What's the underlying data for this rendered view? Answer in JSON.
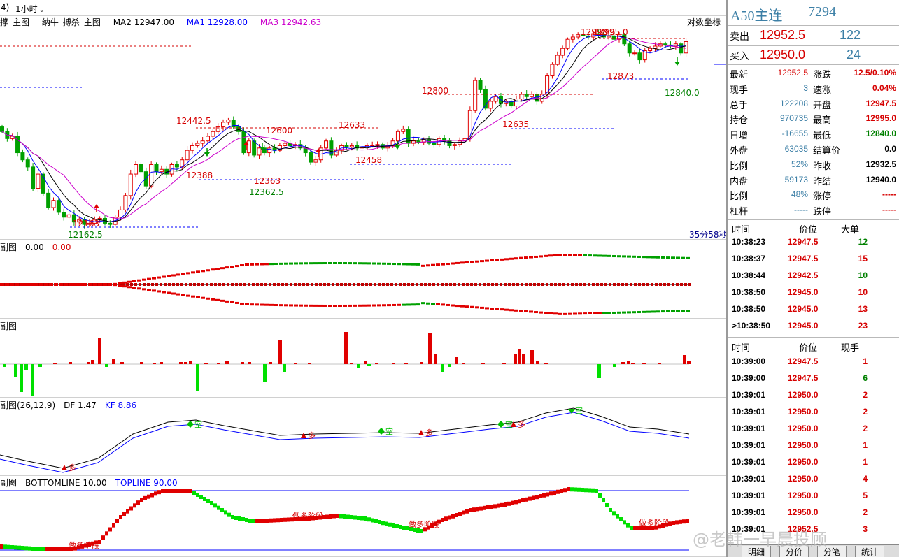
{
  "topbar": {
    "tab1": "4)",
    "tab2": "1小时"
  },
  "main_legend": {
    "name": "撑_主图",
    "name2": "纳牛_搏杀_主图",
    "ma2": "MA2 12947.00",
    "ma1": "MA1 12928.00",
    "ma3": "MA3 12942.63",
    "coord": "对数坐标",
    "countdown": "35分58秒"
  },
  "annotations": {
    "high": "12998.5",
    "high2": "12995.0",
    "a12873": "12873",
    "a12840": "12840.0",
    "a12800": "12800",
    "a12635": "12635",
    "a12633": "12633",
    "a12600": "12600",
    "a12458": "12458",
    "a12442": "12442.5",
    "a12388": "12388",
    "a12363": "12363",
    "a12362": "12362.5",
    "a12163": "12163",
    "a12162": "12162.5"
  },
  "sub1": {
    "name": "副图",
    "v1": "0.00",
    "v2": "0.00"
  },
  "sub2": {
    "name": "副图"
  },
  "sub3": {
    "name": "副图(26,12,9)",
    "df": "DF 1.47",
    "kf": "KF 8.86",
    "kong": "空",
    "duo": "多"
  },
  "sub4": {
    "name": "副图",
    "bottom": "BOTTOMLINE 10.00",
    "top": "TOPLINE 90.00",
    "stage": "做多阶段"
  },
  "quote": {
    "title": "A50主连",
    "code": "7294",
    "sell_label": "卖出",
    "sell_price": "12952.5",
    "sell_vol": "122",
    "buy_label": "买入",
    "buy_price": "12950.0",
    "buy_vol": "24",
    "stats_left": [
      {
        "k": "最新",
        "v": "12952.5",
        "c": "#d60000"
      },
      {
        "k": "现手",
        "v": "3",
        "c": "#3c7fa6"
      },
      {
        "k": "总手",
        "v": "122208",
        "c": "#3c7fa6"
      },
      {
        "k": "持仓",
        "v": "970735",
        "c": "#3c7fa6"
      },
      {
        "k": "日增",
        "v": "-16655",
        "c": "#3c7fa6"
      },
      {
        "k": "外盘",
        "v": "63035",
        "c": "#3c7fa6"
      },
      {
        "k": "比例",
        "v": "52%",
        "c": "#3c7fa6"
      },
      {
        "k": "内盘",
        "v": "59173",
        "c": "#3c7fa6"
      },
      {
        "k": "比例",
        "v": "48%",
        "c": "#3c7fa6"
      },
      {
        "k": "杠杆",
        "v": "-----",
        "c": "#3c7fa6"
      }
    ],
    "stats_right": [
      {
        "k": "涨跌",
        "v": "12.5/0.10%",
        "c": "#d60000"
      },
      {
        "k": "速涨",
        "v": "0.04%",
        "c": "#d60000"
      },
      {
        "k": "开盘",
        "v": "12947.5",
        "c": "#d60000"
      },
      {
        "k": "最高",
        "v": "12995.0",
        "c": "#d60000"
      },
      {
        "k": "最低",
        "v": "12840.0",
        "c": "#008000"
      },
      {
        "k": "结算价",
        "v": "0.0",
        "c": "#000000"
      },
      {
        "k": "昨收",
        "v": "12932.5",
        "c": "#000000"
      },
      {
        "k": "昨结",
        "v": "12940.0",
        "c": "#000000"
      },
      {
        "k": "涨停",
        "v": "-----",
        "c": "#d60000"
      },
      {
        "k": "跌停",
        "v": "-----",
        "c": "#d60000"
      }
    ]
  },
  "big_orders": {
    "headers": [
      "时间",
      "价位",
      "大单"
    ],
    "rows": [
      {
        "t": "10:38:23",
        "p": "12947.5",
        "v": "12",
        "c": "#008000"
      },
      {
        "t": "10:38:37",
        "p": "12947.5",
        "v": "15",
        "c": "#d60000"
      },
      {
        "t": "10:38:44",
        "p": "12942.5",
        "v": "10",
        "c": "#008000"
      },
      {
        "t": "10:38:50",
        "p": "12945.0",
        "v": "10",
        "c": "#d60000"
      },
      {
        "t": "10:38:50",
        "p": "12945.0",
        "v": "13",
        "c": "#d60000"
      },
      {
        "t": ">10:38:50",
        "p": "12945.0",
        "v": "23",
        "c": "#d60000"
      }
    ]
  },
  "ticks": {
    "headers": [
      "时间",
      "价位",
      "现手"
    ],
    "rows": [
      {
        "t": "10:39:00",
        "p": "12947.5",
        "v": "1",
        "c": "#d60000"
      },
      {
        "t": "10:39:00",
        "p": "12947.5",
        "v": "6",
        "c": "#008000"
      },
      {
        "t": "10:39:01",
        "p": "12950.0",
        "v": "2",
        "c": "#d60000"
      },
      {
        "t": "10:39:01",
        "p": "12950.0",
        "v": "2",
        "c": "#d60000"
      },
      {
        "t": "10:39:01",
        "p": "12950.0",
        "v": "2",
        "c": "#d60000"
      },
      {
        "t": "10:39:01",
        "p": "12950.0",
        "v": "1",
        "c": "#d60000"
      },
      {
        "t": "10:39:01",
        "p": "12950.0",
        "v": "1",
        "c": "#d60000"
      },
      {
        "t": "10:39:01",
        "p": "12950.0",
        "v": "4",
        "c": "#d60000"
      },
      {
        "t": "10:39:01",
        "p": "12950.0",
        "v": "5",
        "c": "#d60000"
      },
      {
        "t": "10:39:01",
        "p": "12950.0",
        "v": "2",
        "c": "#d60000"
      },
      {
        "t": "10:39:01",
        "p": "12952.5",
        "v": "3",
        "c": "#d60000"
      }
    ]
  },
  "tabs": [
    "明细",
    "分价",
    "分笔",
    "统计"
  ],
  "watermark": "@老韩一早晨投顾",
  "colors": {
    "up": "#e00000",
    "down": "#00a000",
    "ma1": "#000000",
    "ma2": "#0000ff",
    "ma3": "#cc00cc"
  },
  "chart_data": {
    "type": "candlestick",
    "y_axis": "log",
    "price_range": [
      12130,
      13010
    ],
    "candles_close": [
      12560,
      12530,
      12540,
      12470,
      12440,
      12410,
      12320,
      12380,
      12300,
      12240,
      12270,
      12220,
      12200,
      12210,
      12180,
      12190,
      12170,
      12175,
      12190,
      12195,
      12175,
      12170,
      12200,
      12230,
      12290,
      12380,
      12420,
      12390,
      12330,
      12420,
      12390,
      12400,
      12380,
      12420,
      12410,
      12440,
      12480,
      12500,
      12510,
      12520,
      12540,
      12560,
      12580,
      12600,
      12610,
      12580,
      12560,
      12470,
      12520,
      12460,
      12490,
      12470,
      12490,
      12480,
      12500,
      12510,
      12500,
      12505,
      12490,
      12470,
      12430,
      12440,
      12490,
      12520,
      12460,
      12480,
      12500,
      12495,
      12500,
      12490,
      12495,
      12500,
      12500,
      12505,
      12490,
      12500,
      12520,
      12560,
      12570,
      12510,
      12520,
      12515,
      12525,
      12510,
      12505,
      12530,
      12520,
      12500,
      12505,
      12520,
      12530,
      12650,
      12780,
      12740,
      12660,
      12690,
      12710,
      12680,
      12690,
      12670,
      12700,
      12720,
      12710,
      12720,
      12690,
      12720,
      12800,
      12850,
      12890,
      12920,
      12960,
      12970,
      12980,
      12975,
      12970,
      12985,
      12980,
      12970,
      12975,
      12960,
      12980,
      12940,
      12900,
      12900,
      12870,
      12910,
      12920,
      12930,
      12940,
      12935,
      12930,
      12940,
      12900,
      12950
    ]
  }
}
